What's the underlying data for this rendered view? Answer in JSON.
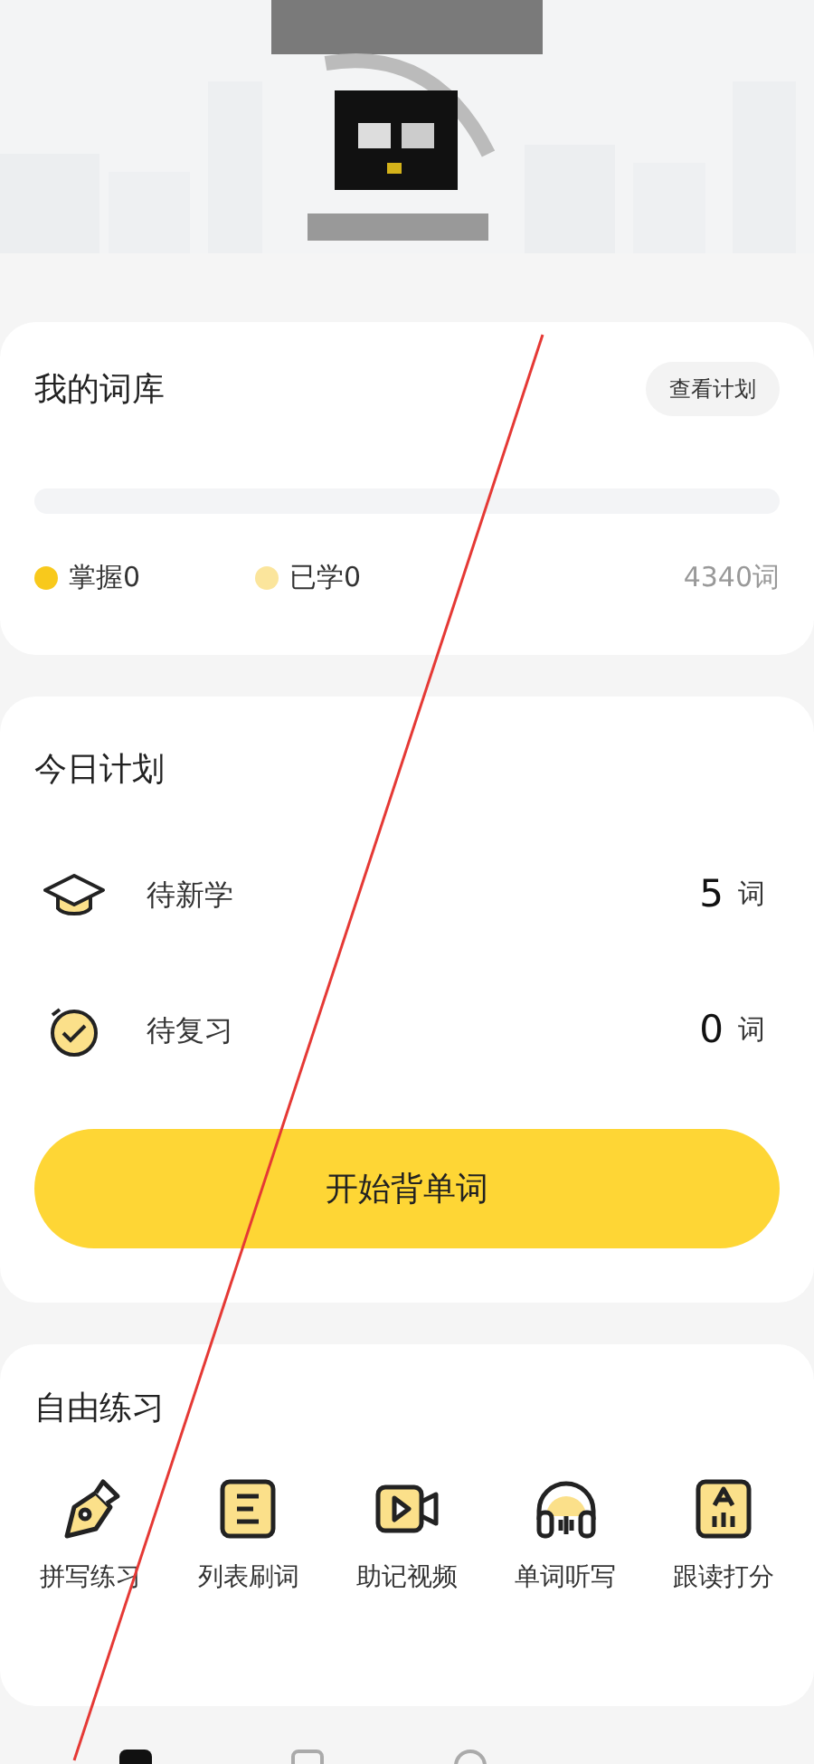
{
  "library": {
    "title": "我的词库",
    "plan_button": "查看计划",
    "progress": {
      "level": 0
    },
    "stats": [
      {
        "label": "掌握0",
        "color": "#f8c91c"
      },
      {
        "label": "已学0",
        "color": "#fbe59c"
      }
    ],
    "total": "4340词"
  },
  "today": {
    "title": "今日计划",
    "rows": [
      {
        "label": "待新学",
        "count": "5",
        "unit": "词"
      },
      {
        "label": "待复习",
        "count": "0",
        "unit": "词"
      }
    ],
    "start_button": "开始背单词"
  },
  "practice": {
    "title": "自由练习",
    "items": [
      {
        "label": "拼写练习"
      },
      {
        "label": "列表刷词"
      },
      {
        "label": "助记视频"
      },
      {
        "label": "单词听写"
      },
      {
        "label": "跟读打分"
      }
    ]
  }
}
